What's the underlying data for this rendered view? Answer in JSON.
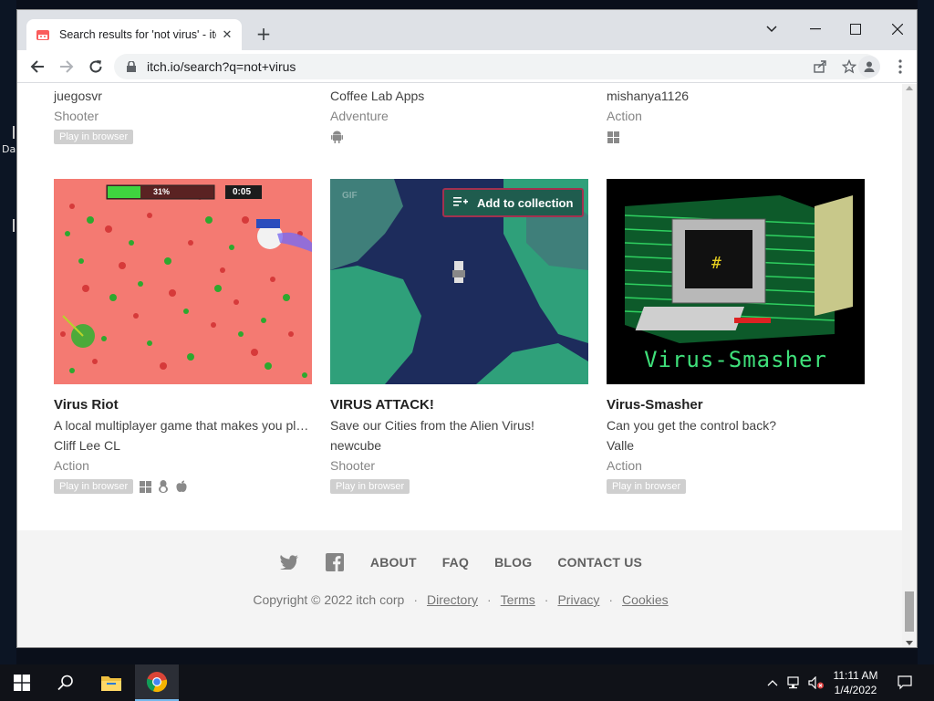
{
  "desktop": {
    "icon_label": "Da"
  },
  "browser": {
    "tab_title": "Search results for 'not virus' - itch.io",
    "url": "itch.io/search?q=not+virus"
  },
  "previous_row": [
    {
      "author": "juegosvr",
      "genre": "Shooter",
      "play_badge": "Play in browser",
      "platform_icons": []
    },
    {
      "author": "Coffee Lab Apps",
      "genre": "Adventure",
      "play_badge": null,
      "platform_icons": [
        "android-icon"
      ]
    },
    {
      "author": "mishanya1126",
      "genre": "Action",
      "play_badge": null,
      "platform_icons": [
        "windows-icon"
      ]
    }
  ],
  "games": [
    {
      "title": "Virus Riot",
      "description": "A local multiplayer game that makes you play with your friends",
      "author": "Cliff Lee CL",
      "genre": "Action",
      "play_badge": "Play in browser",
      "platform_icons": [
        "windows-icon",
        "linux-icon",
        "apple-icon"
      ],
      "thumb": {
        "health": "31%",
        "timer": "0:05"
      }
    },
    {
      "title": "VIRUS ATTACK!",
      "description": "Save our Cities from the Alien Virus!",
      "author": "newcube",
      "genre": "Shooter",
      "play_badge": "Play in browser",
      "platform_icons": [],
      "thumb": {
        "gif_badge": "GIF",
        "collection_button": "Add to collection"
      }
    },
    {
      "title": "Virus-Smasher",
      "description": "Can you get the control back?",
      "author": "Valle",
      "genre": "Action",
      "play_badge": "Play in browser",
      "platform_icons": [],
      "thumb": {
        "banner": "Virus-Smasher"
      }
    }
  ],
  "footer": {
    "links": [
      "ABOUT",
      "FAQ",
      "BLOG",
      "CONTACT US"
    ],
    "copyright": "Copyright © 2022 itch corp",
    "bottom_links": [
      "Directory",
      "Terms",
      "Privacy",
      "Cookies"
    ]
  },
  "taskbar": {
    "time": "11:11 AM",
    "date": "1/4/2022"
  },
  "colors": {
    "accent": "#fa5c5c",
    "badge": "#cfcfcf",
    "collection_border": "#a3314f"
  }
}
